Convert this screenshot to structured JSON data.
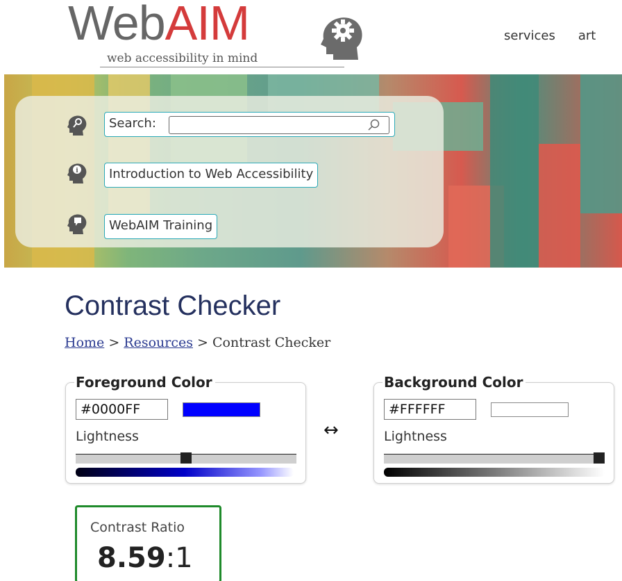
{
  "header": {
    "logo_web": "Web",
    "logo_aim": "AIM",
    "tagline": "web accessibility in mind",
    "nav": [
      "services",
      "art"
    ]
  },
  "banner": {
    "search_label": "Search:",
    "search_value": "",
    "links": [
      "Introduction to Web Accessibility",
      "WebAIM Training"
    ]
  },
  "page": {
    "title": "Contrast Checker",
    "breadcrumb": {
      "home": "Home",
      "resources": "Resources",
      "sep": ">",
      "current": "Contrast Checker"
    }
  },
  "foreground": {
    "legend": "Foreground Color",
    "hex": "#0000FF",
    "swatch_color": "#0000ff",
    "lightness_label": "Lightness",
    "lightness": 0.5
  },
  "background": {
    "legend": "Background Color",
    "hex": "#FFFFFF",
    "swatch_color": "#ffffff",
    "lightness_label": "Lightness",
    "lightness": 1.0
  },
  "swap_symbol": "↔",
  "ratio": {
    "label": "Contrast Ratio",
    "value": "8.59",
    "suffix": ":1",
    "pass_color": "#1e8a2a"
  },
  "icons": [
    "head-gear-icon",
    "search-head-icon",
    "info-head-icon",
    "training-head-icon",
    "magnifier-icon",
    "swap-arrows-icon"
  ]
}
